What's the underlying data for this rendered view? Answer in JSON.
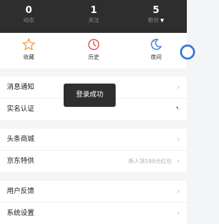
{
  "stats": [
    {
      "value": "0",
      "label": "动态"
    },
    {
      "value": "1",
      "label": "关注"
    },
    {
      "value": "5",
      "label": "粉丝",
      "caret": "▼"
    }
  ],
  "quick_actions": [
    {
      "label": "收藏",
      "icon": "star-icon"
    },
    {
      "label": "历史",
      "icon": "clock-icon"
    },
    {
      "label": "夜间",
      "icon": "moon-icon"
    }
  ],
  "menu": {
    "group1": [
      {
        "label": "消息通知"
      },
      {
        "label": "实名认证"
      }
    ],
    "group2": [
      {
        "label": "头条商城"
      },
      {
        "label": "京东特供",
        "extra": "新人领188元红包"
      }
    ],
    "group3": [
      {
        "label": "用户反馈"
      },
      {
        "label": "系统设置"
      }
    ]
  },
  "toast": {
    "text": "登录成功"
  },
  "colors": {
    "header_bg": "#2e2e2e",
    "accent_blue": "#3a7bd5",
    "toast_bg": "#2f2f2f"
  }
}
